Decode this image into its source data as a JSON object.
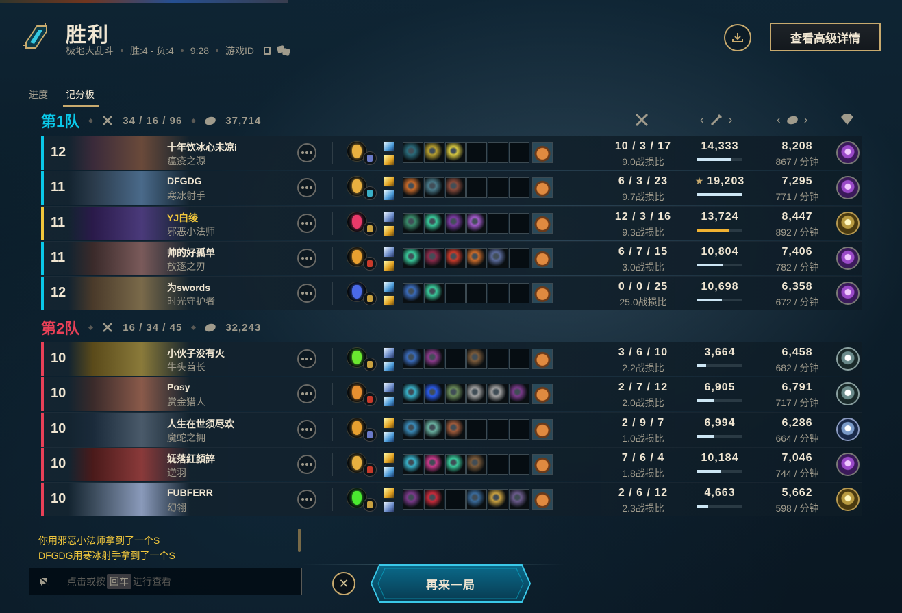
{
  "header": {
    "title": "胜利",
    "mode": "极地大乱斗",
    "record": "胜:4 - 负:4",
    "duration": "9:28",
    "game_id_label": "游戏ID",
    "advanced_button": "查看高级详情"
  },
  "tabs": [
    {
      "label": "进度",
      "active": false
    },
    {
      "label": "记分板",
      "active": true
    }
  ],
  "colors": {
    "team1": "#0ac8e8",
    "team2": "#e84057",
    "me": "#f0c63c",
    "gold_accent": "#c8aa6e"
  },
  "teams": [
    {
      "name": "第1队",
      "kda": "34 / 16 / 96",
      "gold": "37,714",
      "players": [
        {
          "level": "12",
          "name": "十年饮冰心未凉i",
          "champion": "瘟疫之源",
          "kda": "10 / 3 / 17",
          "ratio": "9.0战损比",
          "damage": "14,333",
          "damage_fill": 0.75,
          "gold": "8,208",
          "gpm": "867 / 分钟",
          "top_damage": false,
          "me": false,
          "keystone_color": "#e8b040",
          "secondary_color": "#6a7ac8",
          "spells": [
            "flash",
            "ignite"
          ],
          "items": [
            "#2a6a7a",
            "#b8a030",
            "#d8c840",
            "",
            "",
            "",
            ""
          ],
          "augment": "purple"
        },
        {
          "level": "11",
          "name": "DFGDG",
          "champion": "寒冰射手",
          "kda": "6 / 3 / 23",
          "ratio": "9.7战损比",
          "damage": "19,203",
          "damage_fill": 1.0,
          "gold": "7,295",
          "gpm": "771 / 分钟",
          "top_damage": true,
          "me": false,
          "keystone_color": "#e8b040",
          "secondary_color": "#3ab0c8",
          "spells": [
            "ignite",
            "flash"
          ],
          "items": [
            "#c86a2a",
            "#4a7a8a",
            "#8a4a3a",
            "",
            "",
            "",
            ""
          ],
          "augment": "purple"
        },
        {
          "level": "11",
          "name": "YJ白绫",
          "champion": "邪恶小法师",
          "kda": "12 / 3 / 16",
          "ratio": "9.3战损比",
          "damage": "13,724",
          "damage_fill": 0.71,
          "gold": "8,447",
          "gpm": "892 / 分钟",
          "top_damage": false,
          "me": true,
          "keystone_color": "#e83a6a",
          "secondary_color": "#c8a040",
          "spells": [
            "mark",
            "ignite"
          ],
          "items": [
            "#3a8a6a",
            "#3ac89a",
            "#7a3aa0",
            "#a05ac8",
            "",
            "",
            ""
          ],
          "augment": "gold"
        },
        {
          "level": "11",
          "name": "帅的好孤单",
          "champion": "放逐之刃",
          "kda": "6 / 7 / 15",
          "ratio": "3.0战损比",
          "damage": "10,804",
          "damage_fill": 0.56,
          "gold": "7,406",
          "gpm": "782 / 分钟",
          "top_damage": false,
          "me": false,
          "keystone_color": "#e8a030",
          "secondary_color": "#c83a2a",
          "spells": [
            "mark",
            "ignite"
          ],
          "items": [
            "#3ac89a",
            "#8a2a4a",
            "#c83a2a",
            "#c86a2a",
            "#5a6a9a",
            "",
            ""
          ],
          "augment": "purple"
        },
        {
          "level": "12",
          "name": "为swords",
          "champion": "时光守护者",
          "kda": "0 / 0 / 25",
          "ratio": "25.0战损比",
          "damage": "10,698",
          "damage_fill": 0.55,
          "gold": "6,358",
          "gpm": "672 / 分钟",
          "top_damage": false,
          "me": false,
          "keystone_color": "#4a6ae8",
          "secondary_color": "#c8a040",
          "spells": [
            "flash",
            "ignite"
          ],
          "items": [
            "#3a6ab8",
            "#3ac89a",
            "",
            "",
            "",
            "",
            ""
          ],
          "augment": "purple"
        }
      ]
    },
    {
      "name": "第2队",
      "kda": "16 / 34 / 45",
      "gold": "32,243",
      "players": [
        {
          "level": "10",
          "name": "小伙子没有火",
          "champion": "牛头酋长",
          "kda": "3 / 6 / 10",
          "ratio": "2.2战损比",
          "damage": "3,664",
          "damage_fill": 0.19,
          "gold": "6,458",
          "gpm": "682 / 分钟",
          "top_damage": false,
          "me": false,
          "keystone_color": "#6ae830",
          "secondary_color": "#c8a040",
          "spells": [
            "mark",
            "flash"
          ],
          "items": [
            "#3a6ab8",
            "#8a3a8a",
            "",
            "#7a5a3a",
            "",
            "",
            ""
          ],
          "augment": "silver"
        },
        {
          "level": "10",
          "name": "Posy",
          "champion": "赏金猎人",
          "kda": "2 / 7 / 12",
          "ratio": "2.0战损比",
          "damage": "6,905",
          "damage_fill": 0.36,
          "gold": "6,791",
          "gpm": "717 / 分钟",
          "top_damage": false,
          "me": false,
          "keystone_color": "#e89030",
          "secondary_color": "#c83a2a",
          "spells": [
            "mark",
            "flash"
          ],
          "items": [
            "#3ab0c8",
            "#2a5ae8",
            "#6a8a5a",
            "#a0a0a0",
            "#a0a0a0",
            "#7a3a8a"
          ],
          "augment": "silver"
        },
        {
          "level": "10",
          "name": "人生在世须尽欢",
          "champion": "魔蛇之拥",
          "kda": "2 / 9 / 7",
          "ratio": "1.0战损比",
          "damage": "6,994",
          "damage_fill": 0.36,
          "gold": "6,286",
          "gpm": "664 / 分钟",
          "top_damage": false,
          "me": false,
          "keystone_color": "#e8a030",
          "secondary_color": "#6a7ac8",
          "spells": [
            "ignite",
            "flash"
          ],
          "items": [
            "#3a8ab8",
            "#6ab0a0",
            "#a05a3a",
            "",
            "",
            "",
            ""
          ],
          "augment": "blue"
        },
        {
          "level": "10",
          "name": "妩落紅顏誶",
          "champion": "逆羽",
          "kda": "7 / 6 / 4",
          "ratio": "1.8战损比",
          "damage": "10,184",
          "damage_fill": 0.53,
          "gold": "7,046",
          "gpm": "744 / 分钟",
          "top_damage": false,
          "me": false,
          "keystone_color": "#e8b040",
          "secondary_color": "#c83a2a",
          "spells": [
            "ignite",
            "flash"
          ],
          "items": [
            "#3ab0c8",
            "#c83a8a",
            "#3ac89a",
            "#7a5a3a",
            "",
            "",
            ""
          ],
          "augment": "purple"
        },
        {
          "level": "10",
          "name": "FUBFERR",
          "champion": "幻翎",
          "kda": "2 / 6 / 12",
          "ratio": "2.3战损比",
          "damage": "4,663",
          "damage_fill": 0.24,
          "gold": "5,662",
          "gpm": "598 / 分钟",
          "top_damage": false,
          "me": false,
          "keystone_color": "#4ae830",
          "secondary_color": "#c8a040",
          "spells": [
            "ignite",
            "mark"
          ],
          "items": [
            "#7a3a8a",
            "#c82a3a",
            "",
            "#3a6a9a",
            "#c8a040",
            "#6a5a8a"
          ],
          "augment": "gold"
        }
      ]
    }
  ],
  "chat": {
    "messages": [
      "你用邪恶小法师拿到了一个S",
      "DFGDG用寒冰射手拿到了一个S"
    ],
    "placeholder_pre": "点击或按",
    "placeholder_key": "回车",
    "placeholder_post": "进行查看"
  },
  "play_again_label": "再来一局",
  "icons": [
    "download-icon",
    "copy-icon",
    "dice-icon",
    "kda-swords-icon",
    "gold-coins-icon",
    "damage-sword-icon",
    "chevron-left-icon",
    "chevron-right-icon",
    "augment-heart-icon",
    "more-options-icon",
    "mute-chat-icon",
    "close-icon"
  ]
}
